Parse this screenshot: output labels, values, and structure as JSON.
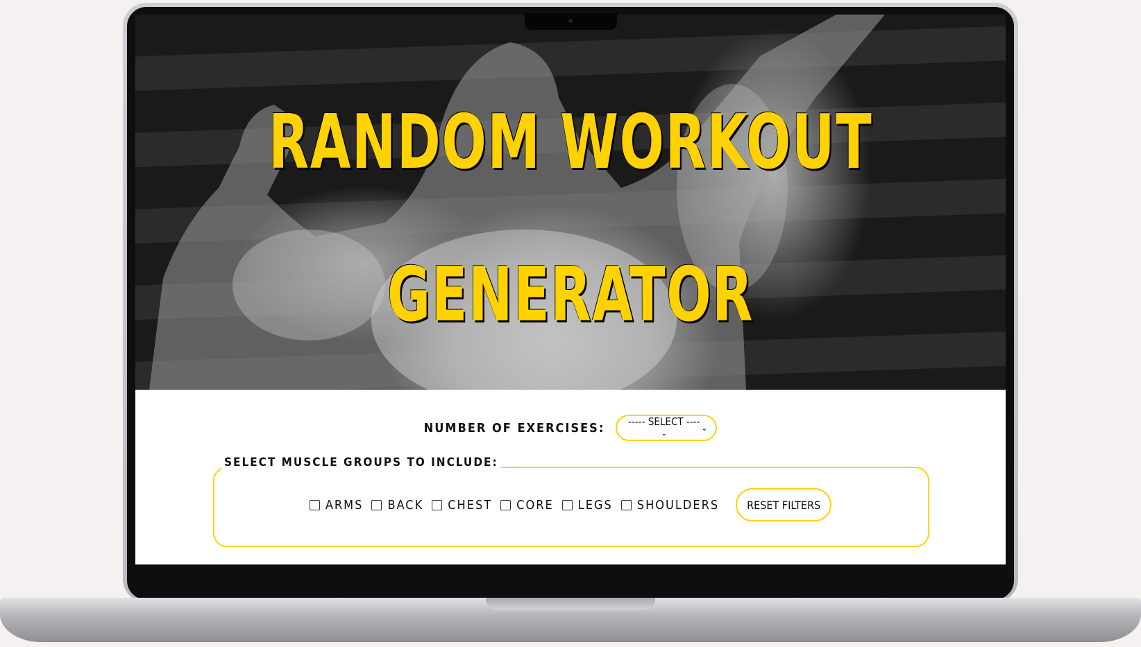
{
  "hero": {
    "title_line1": "RANDOM WORKOUT",
    "title_line2": "GENERATOR"
  },
  "form": {
    "exercises_label": "NUMBER OF EXERCISES:",
    "exercises_select_value": "----- SELECT -----",
    "muscle_groups_legend": "SELECT MUSCLE GROUPS TO INCLUDE:",
    "muscle_groups": [
      {
        "label": "ARMS",
        "checked": false
      },
      {
        "label": "BACK",
        "checked": false
      },
      {
        "label": "CHEST",
        "checked": false
      },
      {
        "label": "CORE",
        "checked": false
      },
      {
        "label": "LEGS",
        "checked": false
      },
      {
        "label": "SHOULDERS",
        "checked": false
      }
    ],
    "reset_label": "RESET FILTERS"
  },
  "theme": {
    "accent": "#ffd200",
    "panel_bg": "#ffffff",
    "text": "#111111"
  }
}
